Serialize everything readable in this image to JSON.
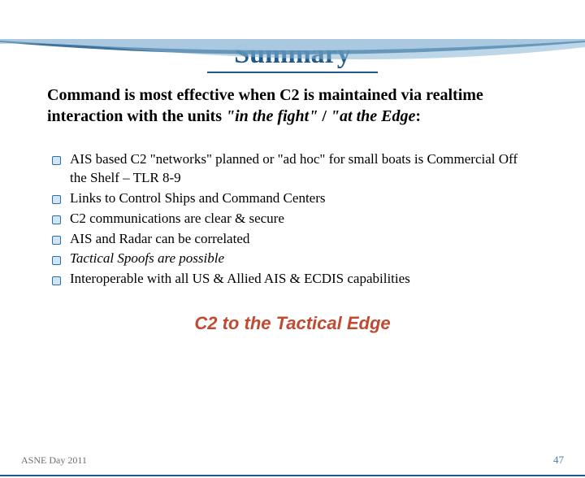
{
  "title": "Summary",
  "lead": {
    "prefix": "Command is most effective when C2 is maintained via realtime interaction with the units ",
    "quote1": "\"in the fight\"",
    "sep": " / ",
    "quote2": "\"at the Edge",
    "suffix": ":"
  },
  "bullets": [
    "AIS based C2 \"networks\" planned or \"ad hoc\" for small boats is Commercial Off the Shelf – TLR 8-9",
    "Links to Control Ships and Command Centers",
    "C2 communications are clear & secure",
    "AIS and Radar can be correlated",
    "Tactical Spoofs are possible",
    "Interoperable with all US & Allied AIS & ECDIS capabilities"
  ],
  "bullet_italic_index": 4,
  "subheading": "C2 to the Tactical Edge",
  "footer_left": "ASNE Day 2011",
  "footer_right": "47"
}
